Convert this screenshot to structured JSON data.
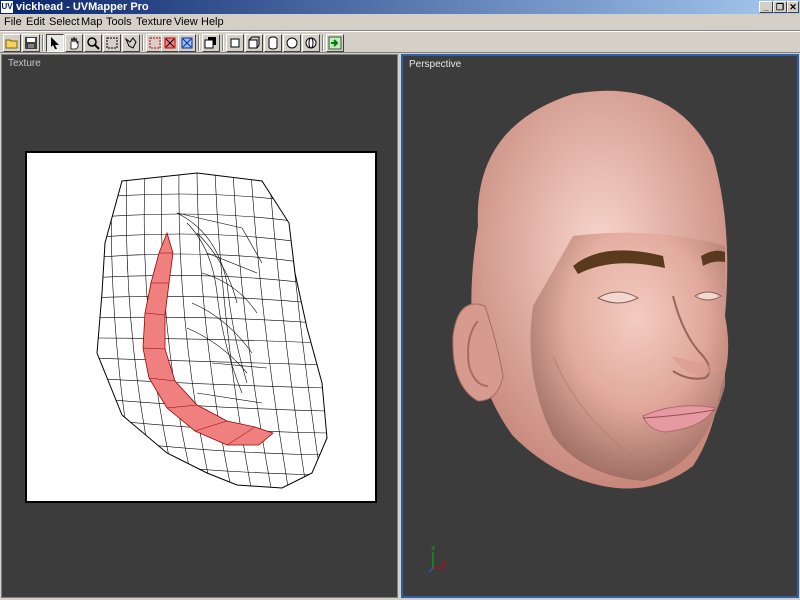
{
  "window": {
    "app_icon_text": "UV",
    "title": "vickhead - UVMapper Pro",
    "min_symbol": "_",
    "restore_symbol": "❐",
    "close_symbol": "✕"
  },
  "menus": [
    "File",
    "Edit",
    "Select",
    "Map",
    "Tools",
    "Texture",
    "View",
    "Help"
  ],
  "toolbar": {
    "icons": [
      "open-folder-icon",
      "save-icon",
      "select-arrow-icon",
      "hand-pan-icon",
      "zoom-icon",
      "rectangle-select-icon",
      "lasso-select-icon",
      "select-box-red-icon",
      "deselect-box-red-icon",
      "invert-box-blue-icon",
      "copy-view-icon",
      "plane-map-icon",
      "box-map-icon",
      "cylinder-map-icon",
      "sphere-map-icon",
      "polar-map-icon",
      "apply-arrow-icon"
    ]
  },
  "views": {
    "texture_label": "Texture",
    "perspective_label": "Perspective"
  },
  "axes": {
    "y": "Y",
    "x": "X"
  },
  "colors": {
    "viewport_bg": "#3c3c3c",
    "active_border": "#2e5fa8",
    "selection_fill": "#f08080",
    "skin": "#e8b4a8",
    "eyebrow": "#5a3a1e"
  }
}
